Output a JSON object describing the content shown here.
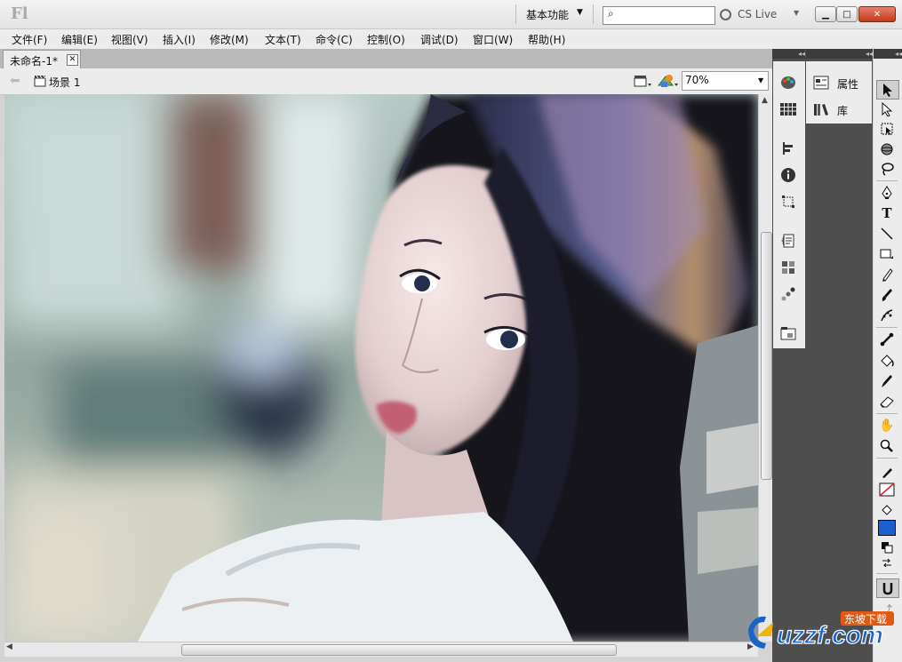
{
  "app": {
    "logo": "Fl"
  },
  "titlebar": {
    "workspace": "基本功能",
    "search_placeholder": "",
    "cs_live": "CS Live",
    "window_buttons": [
      "minimize",
      "maximize",
      "close"
    ]
  },
  "menu": [
    "文件(F)",
    "编辑(E)",
    "视图(V)",
    "插入(I)",
    "修改(M)",
    "文本(T)",
    "命令(C)",
    "控制(O)",
    "调试(D)",
    "窗口(W)",
    "帮助(H)"
  ],
  "document": {
    "tab_label": "未命名-1*",
    "scene_label": "场景 1",
    "zoom": "70%"
  },
  "panels": {
    "properties_label": "属性",
    "library_label": "库"
  },
  "tools": [
    "selection-tool",
    "subselection-tool",
    "free-transform-tool",
    "3d-rotation-tool",
    "lasso-tool",
    "pen-tool",
    "text-tool",
    "line-tool",
    "rectangle-tool",
    "pencil-tool",
    "brush-tool",
    "deco-tool",
    "bone-tool",
    "paint-bucket-tool",
    "eyedropper-tool",
    "eraser-tool",
    "hand-tool",
    "zoom-tool",
    "stroke-color",
    "fill-color",
    "swap-colors",
    "snap-to-objects"
  ],
  "colors": {
    "fill_swatch": "#1a5fcf",
    "stroke_swatch": "#ffffff"
  },
  "watermark": {
    "text": "uzzf.com",
    "badge": "东坡下载"
  }
}
